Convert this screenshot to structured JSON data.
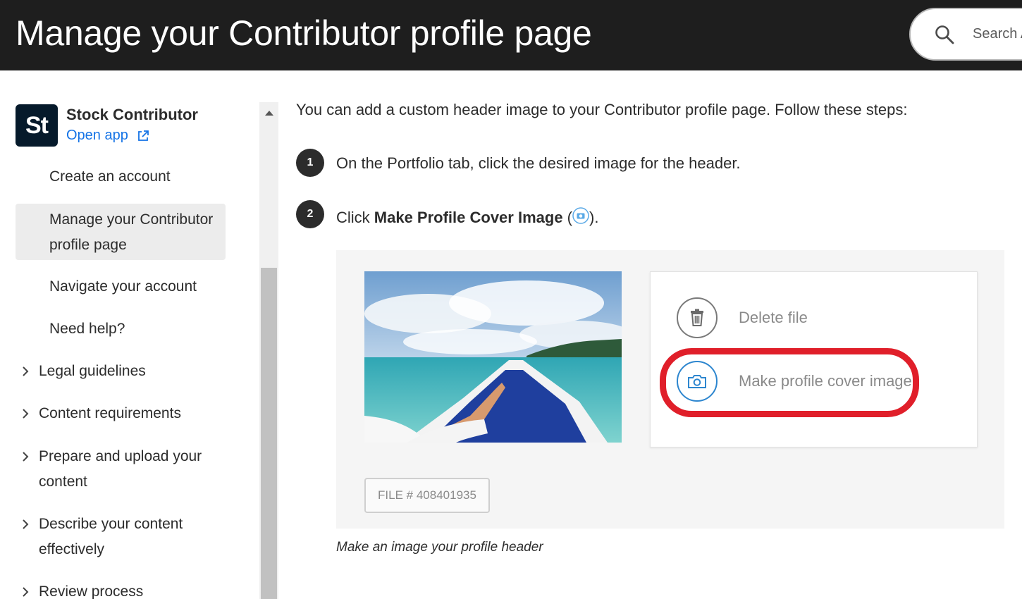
{
  "header": {
    "title": "Manage your Contributor profile page",
    "search_placeholder": "Search A"
  },
  "sidebar": {
    "app": {
      "logo_text": "St",
      "name": "Stock Contributor",
      "open_app_label": "Open app"
    },
    "items": [
      {
        "label": "Create an account"
      },
      {
        "label": "Manage your Contributor profile page",
        "active": true
      },
      {
        "label": "Navigate your account"
      },
      {
        "label": "Need help?"
      }
    ],
    "groups": [
      {
        "label": "Legal guidelines"
      },
      {
        "label": "Content requirements"
      },
      {
        "label": "Prepare and upload your content"
      },
      {
        "label": "Describe your content effectively"
      },
      {
        "label": "Review process"
      }
    ]
  },
  "main": {
    "intro": "You can add a custom header image to your Contributor profile page. Follow these steps:",
    "steps": [
      {
        "number": "1",
        "text": "On the Portfolio tab, click the desired image for the header."
      },
      {
        "number": "2",
        "prefix": "Click ",
        "bold": "Make Profile Cover Image",
        "open_paren": " (",
        "suffix": ")."
      }
    ],
    "figure": {
      "file_label": "FILE # 408401935",
      "menu": [
        {
          "label": "Delete file",
          "icon": "trash-icon"
        },
        {
          "label": "Make profile cover image",
          "icon": "camera-icon",
          "highlighted": true
        }
      ],
      "caption": "Make an image your profile header"
    }
  },
  "colors": {
    "header_bg": "#1e1e1e",
    "link": "#1473e6",
    "highlight": "#e01f2a",
    "active_nav_bg": "#ececec"
  }
}
